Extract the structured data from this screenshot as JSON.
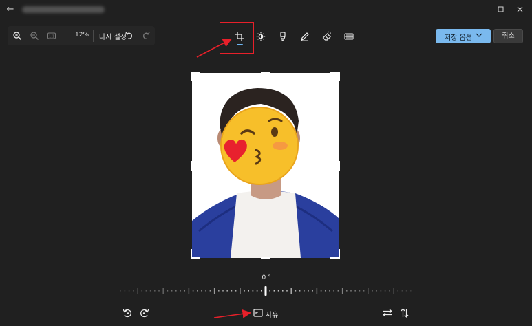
{
  "titlebar": {
    "back_icon": "arrow-left-icon",
    "window_controls": [
      "minimize-icon",
      "maximize-icon",
      "close-icon"
    ]
  },
  "toolbar": {
    "zoom_in_icon": "zoom-in-icon",
    "zoom_out_icon": "zoom-out-icon",
    "actual_size_icon": "actual-size-icon",
    "actual_size_text": "1:1",
    "zoom_level": "12%",
    "reset_label": "다시 설정",
    "undo_icon": "undo-icon",
    "redo_icon": "redo-icon",
    "tools": [
      "crop-icon",
      "brightness-icon",
      "marker-icon",
      "pen-icon",
      "eraser-icon",
      "filter-icon"
    ],
    "save_label": "저장 옵션",
    "cancel_label": "취소"
  },
  "canvas": {
    "rotation_value": "0 °"
  },
  "bottom": {
    "rotate_left_icon": "rotate-left-icon",
    "rotate_right_icon": "rotate-right-icon",
    "aspect_ratio_icon": "aspect-ratio-icon",
    "aspect_ratio_label": "자유",
    "flip_horizontal_icon": "flip-horizontal-icon",
    "flip_vertical_icon": "flip-vertical-icon"
  },
  "colors": {
    "background": "#202020",
    "accent": "#7ab9ee",
    "annotation_red": "#e8202a"
  }
}
